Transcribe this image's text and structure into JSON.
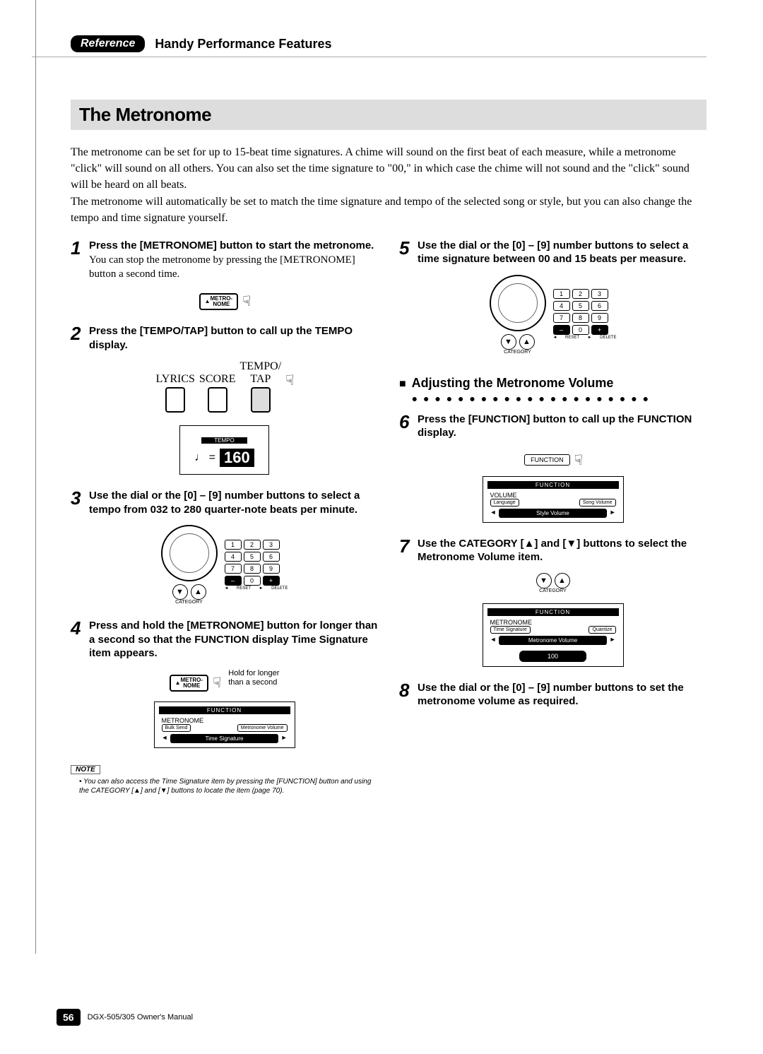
{
  "header": {
    "badge": "Reference",
    "title": "Handy Performance Features"
  },
  "section_title": "The Metronome",
  "intro": "The metronome can be set for up to 15-beat time signatures. A chime will sound on the first beat of each measure, while a metronome \"click\" will sound on all others. You can also set the time signature to \"00,\" in which case the chime will not sound and the \"click\" sound will be heard on all beats.\nThe metronome will automatically be set to match the time signature and tempo of the selected song or style, but you can also change the tempo and time signature yourself.",
  "steps": {
    "s1": {
      "num": "1",
      "title": "Press the [METRONOME] button to start the metronome.",
      "body": "You can stop the metronome by pressing the [MET­RONOME] button a second time."
    },
    "s2": {
      "num": "2",
      "title": "Press the [TEMPO/TAP] button to call up the TEMPO display."
    },
    "s3": {
      "num": "3",
      "title": "Use the dial or the [0] – [9] number buttons to select a tempo from 032 to 280 quarter-note beats per minute."
    },
    "s4": {
      "num": "4",
      "title": "Press and hold the [METRONOME] button for longer than a second so that the FUNC­TION display Time Signature item appears."
    },
    "s5": {
      "num": "5",
      "title": "Use the dial or the [0] – [9] number buttons to select a time signature between 00 and 15 beats per measure."
    },
    "s6": {
      "num": "6",
      "title": "Press the [FUNCTION] button to call up the FUNCTION display."
    },
    "s7": {
      "num": "7",
      "title": "Use the CATEGORY [▲] and [▼] buttons to select the Metronome Volume item."
    },
    "s8": {
      "num": "8",
      "title": "Use the dial or the [0] – [9] number buttons to set the metronome volume as required."
    }
  },
  "buttons": {
    "metronome": "METRO-\nNOME",
    "lyrics": "LYRICS",
    "score": "SCORE",
    "tempo_tap": "TEMPO/\nTAP",
    "function": "FUNCTION",
    "category": "CATEGORY",
    "reset": "RESET",
    "delete": "DELETE"
  },
  "keypad": [
    "1",
    "2",
    "3",
    "4",
    "5",
    "6",
    "7",
    "8",
    "9",
    "–",
    "0",
    "+"
  ],
  "displays": {
    "tempo_label": "TEMPO",
    "tempo_value": "160",
    "function_label": "FUNCTION",
    "lcd1_title": "METRONOME",
    "lcd1_left": "Bulk Send",
    "lcd1_right": "Metronome Volume",
    "lcd1_center": "Time Signature",
    "lcd2_title": "VOLUME",
    "lcd2_left": "Language",
    "lcd2_right": "Song Volume",
    "lcd2_center": "Style Volume",
    "lcd3_title": "METRONOME",
    "lcd3_left": "Time Signature",
    "lcd3_right": "Quantize",
    "lcd3_center": "Metronome Volume",
    "lcd3_value": "100"
  },
  "hold_label": "Hold for longer\nthan a second",
  "note": {
    "head": "NOTE",
    "body": "• You can also access the Time Signature item by pressing the [FUNCTION] button and using the CATEGORY [▲] and [▼] but­tons to locate the item (page 70)."
  },
  "sub_heading": "Adjusting the Metronome Volume",
  "footer": {
    "page": "56",
    "text": "DGX-505/305  Owner's Manual"
  }
}
